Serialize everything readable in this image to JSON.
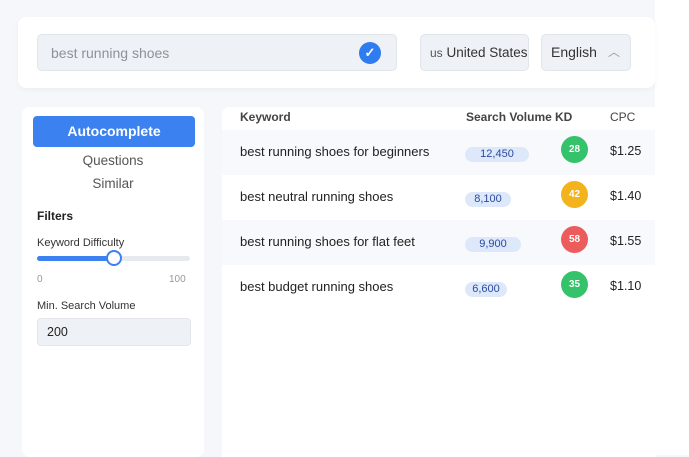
{
  "search": {
    "value": "best running shoes"
  },
  "country": {
    "code": "us",
    "label": "United States"
  },
  "language": {
    "label": "English"
  },
  "sidebar": {
    "tabs": [
      "Autocomplete",
      "Questions",
      "Similar"
    ],
    "filters_title": "Filters",
    "kd_label": "Keyword Difficulty",
    "kd_value_percent": 50,
    "kd_min": "0",
    "kd_max": "100",
    "min_volume_label": "Min. Search Volume",
    "min_volume_value": "200"
  },
  "table": {
    "headers": [
      "Keyword",
      "Search Volume",
      "KD",
      "CPC"
    ],
    "rows": [
      {
        "keyword": "best running shoes for beginners",
        "volume": "12,450",
        "kd": "28",
        "cpc": "$1.25",
        "kd_color": "#34c26a"
      },
      {
        "keyword": "best neutral running shoes",
        "volume": "8,100",
        "kd": "42",
        "cpc": "$1.40",
        "kd_color": "#f2b31c"
      },
      {
        "keyword": "best running shoes for flat feet",
        "volume": "9,900",
        "kd": "58",
        "cpc": "$1.55",
        "kd_color": "#ec5c5c"
      },
      {
        "keyword": "best budget running shoes",
        "volume": "6,600",
        "kd": "35",
        "cpc": "$1.10",
        "kd_color": "#34c26a"
      }
    ]
  },
  "colors": {
    "accent": "#3b82f0"
  }
}
